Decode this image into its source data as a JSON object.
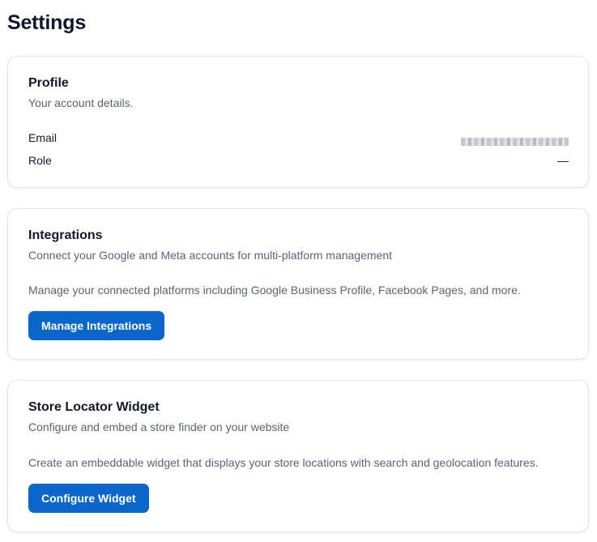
{
  "page": {
    "title": "Settings"
  },
  "profile": {
    "title": "Profile",
    "subtitle": "Your account details.",
    "email_label": "Email",
    "role_label": "Role",
    "role_value": "—"
  },
  "integrations": {
    "title": "Integrations",
    "subtitle": "Connect your Google and Meta accounts for multi-platform management",
    "description": "Manage your connected platforms including Google Business Profile, Facebook Pages, and more.",
    "button_label": "Manage Integrations"
  },
  "store_locator": {
    "title": "Store Locator Widget",
    "subtitle": "Configure and embed a store finder on your website",
    "description": "Create an embeddable widget that displays your store locations with search and geolocation features.",
    "button_label": "Configure Widget"
  },
  "colors": {
    "primary_button": "#0a66c9",
    "card_border": "#e3e6ea",
    "muted_text": "#5b6472"
  }
}
